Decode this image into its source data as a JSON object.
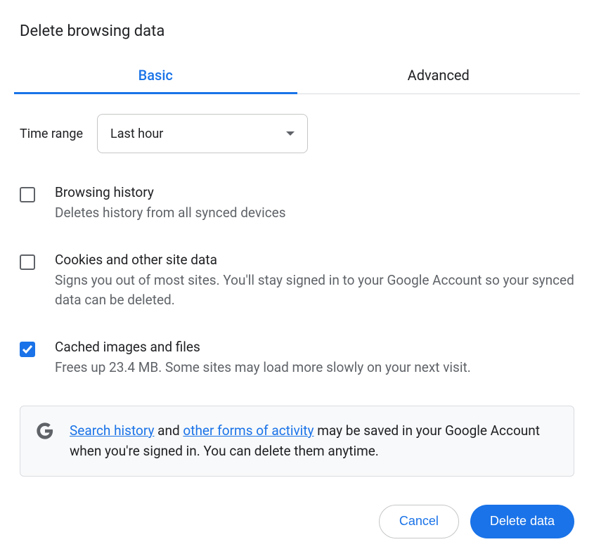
{
  "title": "Delete browsing data",
  "tabs": {
    "basic": "Basic",
    "advanced": "Advanced"
  },
  "time": {
    "label": "Time range",
    "selected": "Last hour"
  },
  "options": [
    {
      "checked": false,
      "title": "Browsing history",
      "desc": "Deletes history from all synced devices"
    },
    {
      "checked": false,
      "title": "Cookies and other site data",
      "desc": "Signs you out of most sites. You'll stay signed in to your Google Account so your synced data can be deleted."
    },
    {
      "checked": true,
      "title": "Cached images and files",
      "desc": "Frees up 23.4 MB. Some sites may load more slowly on your next visit."
    }
  ],
  "info": {
    "link1": "Search history",
    "mid1": " and ",
    "link2": "other forms of activity",
    "rest": " may be saved in your Google Account when you're signed in. You can delete them anytime."
  },
  "buttons": {
    "cancel": "Cancel",
    "delete": "Delete data"
  }
}
